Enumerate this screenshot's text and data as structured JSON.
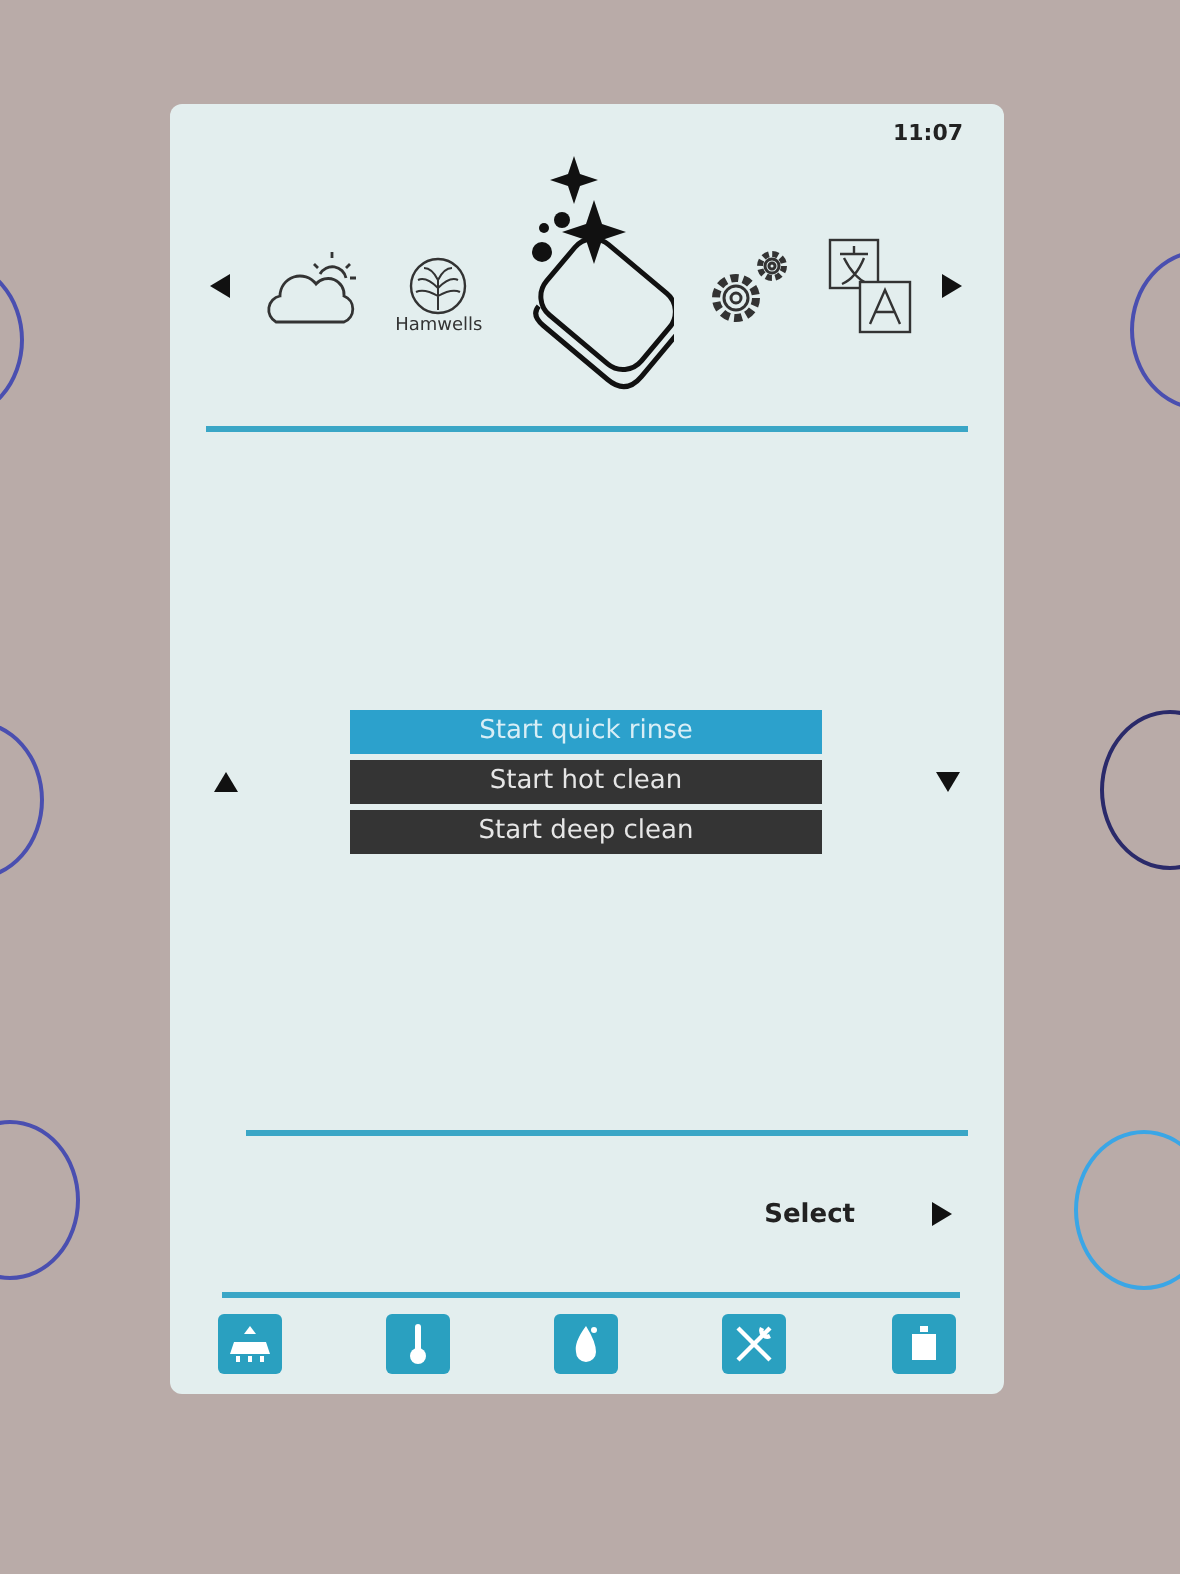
{
  "status_bar": {
    "time": "11:07"
  },
  "carousel": {
    "logo_label": "Hamwells"
  },
  "menu": [
    {
      "label": "Start quick rinse",
      "selected": true
    },
    {
      "label": "Start hot clean",
      "selected": false
    },
    {
      "label": "Start deep clean",
      "selected": false
    }
  ],
  "footer": {
    "select_label": "Select"
  }
}
